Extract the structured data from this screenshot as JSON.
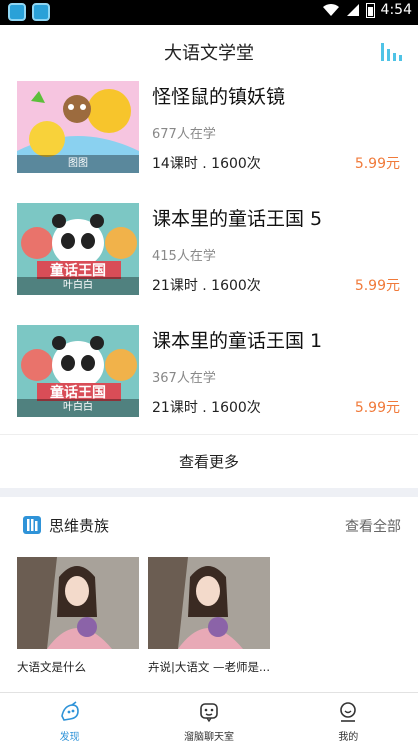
{
  "status_bar": {
    "time": "4:54"
  },
  "header": {
    "title": "大语文学堂",
    "stats_icon": "bar-chart-icon"
  },
  "courses": [
    {
      "title": "怪怪鼠的镇妖镜",
      "students": "677人在学",
      "meta": "14课时 . 1600次",
      "price": "5.99元",
      "caption": "图图"
    },
    {
      "title": "课本里的童话王国 5",
      "students": "415人在学",
      "meta": "21课时 . 1600次",
      "price": "5.99元",
      "caption": "叶白白"
    },
    {
      "title": "课本里的童话王国 1",
      "students": "367人在学",
      "meta": "21课时 . 1600次",
      "price": "5.99元",
      "caption": "叶白白"
    }
  ],
  "more_label": "查看更多",
  "section": {
    "title": "思维贵族",
    "see_all": "查看全部"
  },
  "videos": [
    {
      "title": "大语文是什么"
    },
    {
      "title": "卉说|大语文 —老师是..."
    }
  ],
  "nav": [
    {
      "label": "发现",
      "icon": "discover-icon",
      "active": true
    },
    {
      "label": "溜脑聊天室",
      "icon": "chat-robot-icon",
      "active": false
    },
    {
      "label": "我的",
      "icon": "profile-icon",
      "active": false
    }
  ],
  "colors": {
    "accent": "#2f93d8",
    "price": "#f07a3a",
    "chart_icon": "#4fc3e6"
  }
}
